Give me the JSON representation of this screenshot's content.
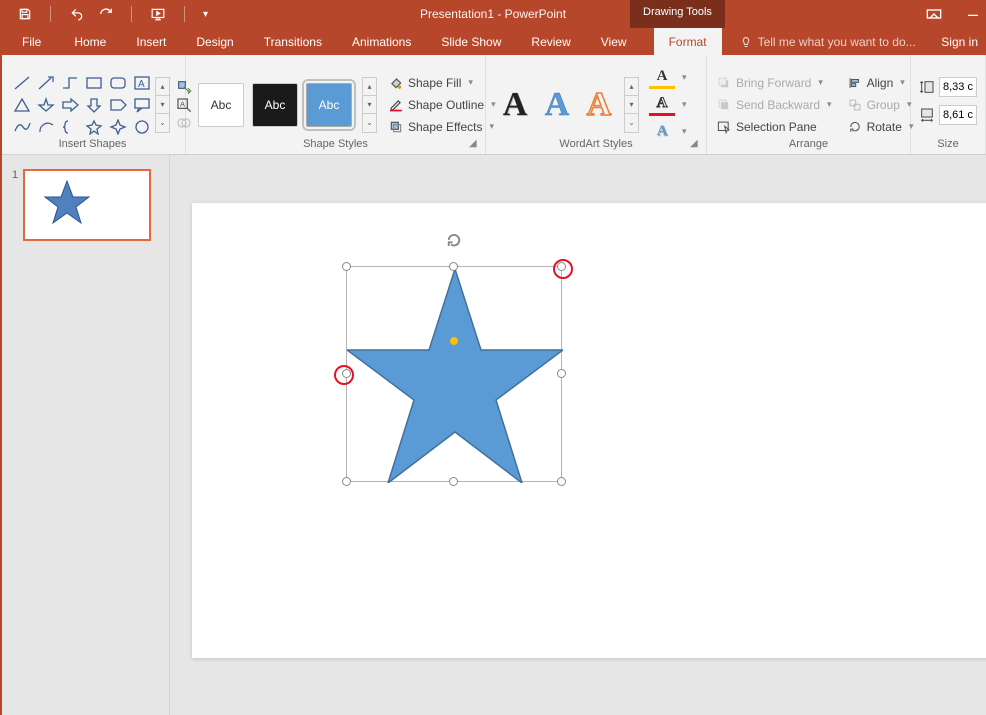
{
  "title": "Presentation1 - PowerPoint",
  "tool_tab": "Drawing Tools",
  "window": {
    "signin": "Sign in"
  },
  "tabs": {
    "file": "File",
    "home": "Home",
    "insert": "Insert",
    "design": "Design",
    "transitions": "Transitions",
    "animations": "Animations",
    "slideshow": "Slide Show",
    "review": "Review",
    "view": "View",
    "format": "Format",
    "tellme": "Tell me what you want to do..."
  },
  "ribbon": {
    "insert_shapes": {
      "label": "Insert Shapes"
    },
    "shape_styles": {
      "label": "Shape Styles",
      "preset_text": "Abc",
      "fill": "Shape Fill",
      "outline": "Shape Outline",
      "effects": "Shape Effects"
    },
    "wordart": {
      "label": "WordArt Styles",
      "glyph": "A"
    },
    "arrange": {
      "label": "Arrange",
      "forward": "Bring Forward",
      "backward": "Send Backward",
      "selection": "Selection Pane",
      "align": "Align",
      "group": "Group",
      "rotate": "Rotate"
    },
    "size": {
      "label": "Size",
      "height": "8,33 c",
      "width": "8,61 c"
    }
  },
  "slide": {
    "number": "1"
  }
}
